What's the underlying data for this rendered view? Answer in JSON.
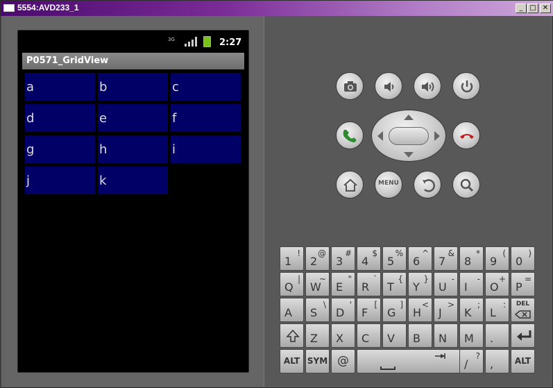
{
  "window": {
    "title": "5554:AVD233_1",
    "min": "_",
    "max": "□",
    "close": "✕"
  },
  "status": {
    "network": "3G",
    "time": "2:27"
  },
  "app": {
    "title": "P0571_GridView",
    "cells": [
      "a",
      "b",
      "c",
      "d",
      "e",
      "f",
      "g",
      "h",
      "i",
      "j",
      "k"
    ],
    "cell_color": "#000066"
  },
  "controls": {
    "menu_label": "MENU"
  },
  "keyboard": {
    "row1": [
      [
        "1",
        "!"
      ],
      [
        "2",
        "@"
      ],
      [
        "3",
        "#"
      ],
      [
        "4",
        "$"
      ],
      [
        "5",
        "%"
      ],
      [
        "6",
        "^"
      ],
      [
        "7",
        "&"
      ],
      [
        "8",
        "*"
      ],
      [
        "9",
        "("
      ],
      [
        "0",
        ")"
      ]
    ],
    "row2": [
      [
        "Q",
        "|"
      ],
      [
        "W",
        "~"
      ],
      [
        "E",
        "\""
      ],
      [
        "R",
        "`"
      ],
      [
        "T",
        "{"
      ],
      [
        "Y",
        "}"
      ],
      [
        "U",
        "-"
      ],
      [
        "I",
        "-"
      ],
      [
        "O",
        "+"
      ],
      [
        "P",
        "="
      ]
    ],
    "row3": [
      [
        "A",
        ""
      ],
      [
        "S",
        "\\"
      ],
      [
        "D",
        "'"
      ],
      [
        "F",
        "["
      ],
      [
        "G",
        "]"
      ],
      [
        "H",
        "<"
      ],
      [
        "J",
        ">"
      ],
      [
        "K",
        ";"
      ],
      [
        "L",
        ":"
      ]
    ],
    "del": "DEL",
    "row4": [
      "Z",
      "X",
      "C",
      "V",
      "B",
      "N",
      "M",
      "."
    ],
    "alt": "ALT",
    "sym": "SYM",
    "at": "@",
    "slash": "/",
    "question": "?",
    "comma": ","
  }
}
